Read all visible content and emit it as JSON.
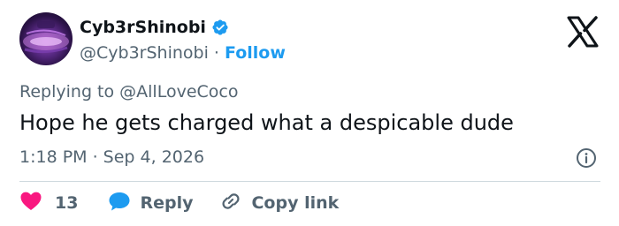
{
  "user": {
    "display_name": "Cyb3rShinobi",
    "handle": "@Cyb3rShinobi",
    "separator": "·",
    "follow_label": "Follow",
    "verified": true
  },
  "tweet": {
    "replying_to": "Replying to @AllLoveCoco",
    "text": "Hope he gets charged what a despicable dude",
    "timestamp": "1:18 PM · Sep 4, 2026"
  },
  "actions": {
    "like_count": "13",
    "reply_label": "Reply",
    "copy_link_label": "Copy link"
  },
  "colors": {
    "like": "#f91880",
    "reply": "#1d9bf0",
    "follow": "#1d9bf0",
    "verified": "#1d9bf0",
    "muted": "#536471",
    "text": "#0f1419",
    "divider": "#cfd9de"
  },
  "icons": {
    "brand": "x-logo-icon",
    "verified": "verified-badge-icon",
    "info": "info-icon",
    "like": "heart-icon",
    "reply": "speech-bubble-icon",
    "copy": "link-icon"
  }
}
